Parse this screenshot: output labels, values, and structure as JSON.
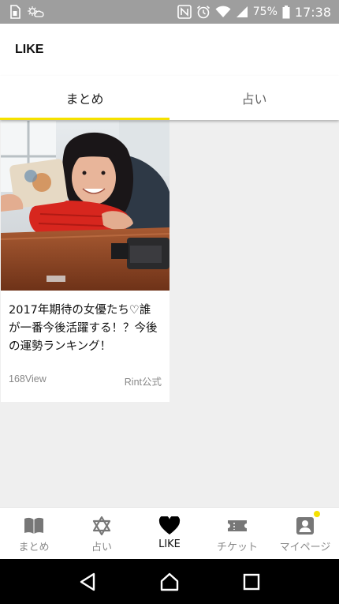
{
  "status_bar": {
    "battery_percent": "75%",
    "time": "17:38",
    "icons": [
      "sim-icon",
      "weather-icon",
      "nfc-icon",
      "alarm-icon",
      "wifi-icon",
      "signal-icon",
      "battery-icon"
    ]
  },
  "header": {
    "title": "LIKE"
  },
  "tabs": [
    {
      "label": "まとめ",
      "active": true
    },
    {
      "label": "占い",
      "active": false
    }
  ],
  "cards": [
    {
      "title": "2017年期待の女優たち♡誰が一番今後活躍する！？今後の運勢ランキング！",
      "views": "168View",
      "source": "Rint公式"
    }
  ],
  "bottom_nav": [
    {
      "label": "まとめ",
      "icon": "book-icon",
      "active": false
    },
    {
      "label": "占い",
      "icon": "star-of-david-icon",
      "active": false
    },
    {
      "label": "LIKE",
      "icon": "heart-icon",
      "active": true
    },
    {
      "label": "チケット",
      "icon": "ticket-icon",
      "active": false
    },
    {
      "label": "マイページ",
      "icon": "user-icon",
      "active": false,
      "badge": true
    }
  ],
  "colors": {
    "accent": "#f5e100",
    "status_bar": "#9e9e9e",
    "background": "#efefef"
  },
  "system_nav": [
    "back-icon",
    "home-icon",
    "recents-icon"
  ]
}
